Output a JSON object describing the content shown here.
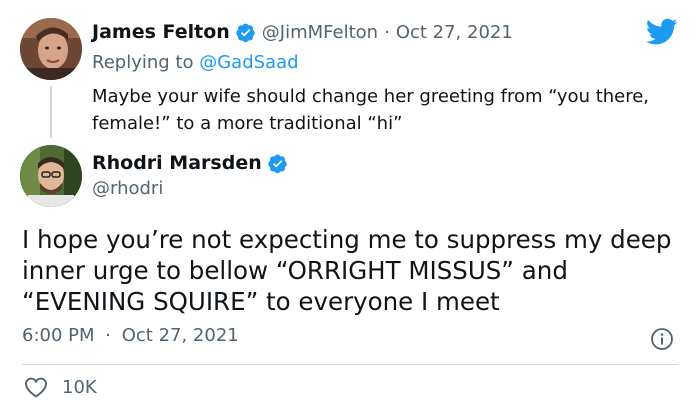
{
  "colors": {
    "twitter_blue": "#1d9bf0",
    "text_primary": "#0f1419",
    "text_secondary": "#536471",
    "divider": "#cfd9de"
  },
  "icons": {
    "logo": "twitter-bird-icon",
    "verified": "verified-badge-icon",
    "info": "info-icon",
    "like": "heart-icon"
  },
  "quoted_tweet": {
    "author_name": "James Felton",
    "author_handle": "@JimMFelton",
    "separator": "·",
    "date": "Oct 27, 2021",
    "replying_prefix": "Replying to",
    "replying_to": "@GadSaad",
    "text": "Maybe your wife should change her greeting from “you there, female!” to a more traditional “hi”"
  },
  "main_tweet": {
    "author_name": "Rhodri Marsden",
    "author_handle": "@rhodri",
    "text": "I hope you’re not expecting me to suppress my deep inner urge to bellow “ORRIGHT MISSUS” and “EVENING SQUIRE” to everyone I meet",
    "time": "6:00 PM",
    "separator": "·",
    "date": "Oct 27, 2021",
    "likes": "10K"
  }
}
